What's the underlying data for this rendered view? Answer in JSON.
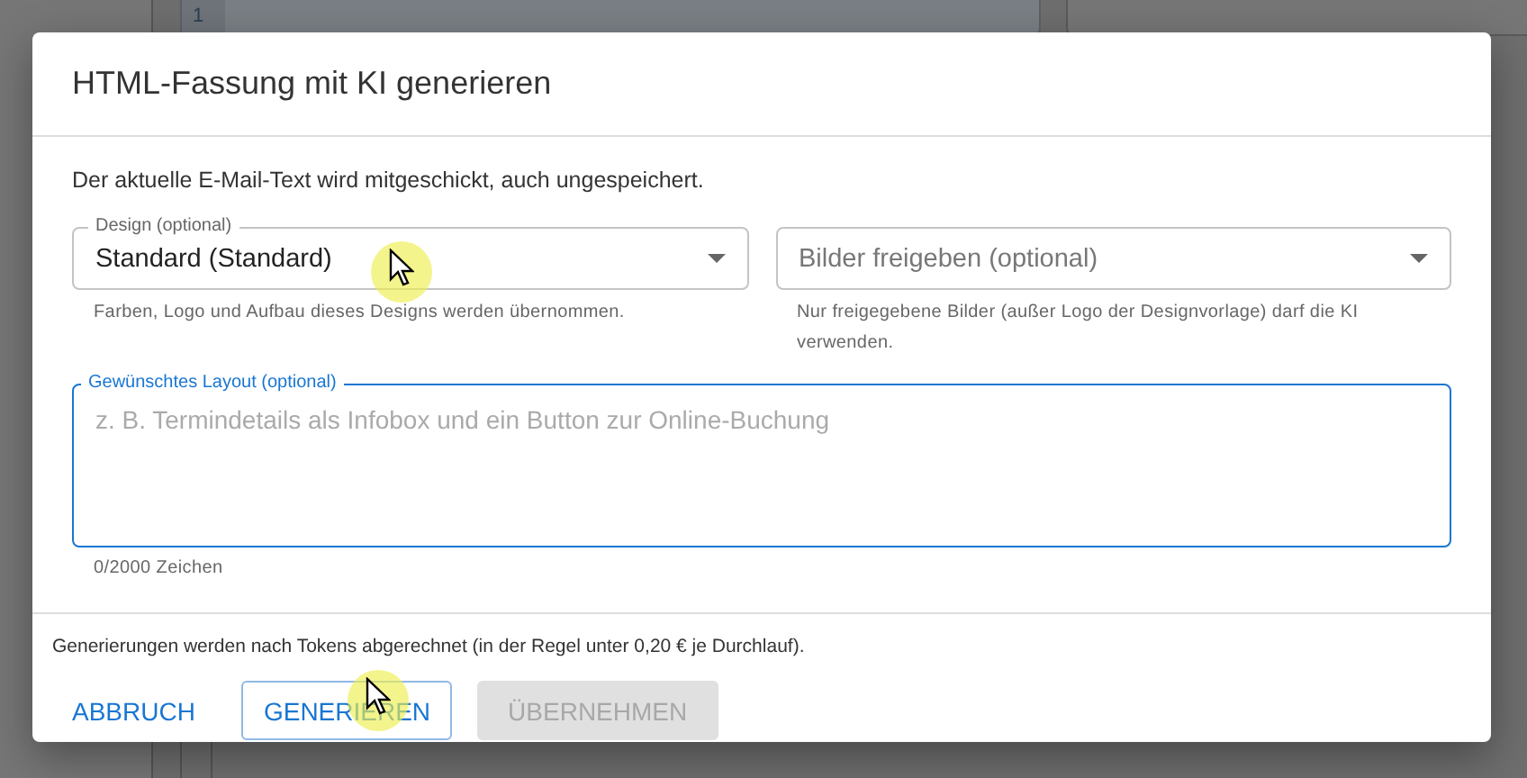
{
  "background": {
    "line_number": "1"
  },
  "dialog": {
    "title": "HTML-Fassung mit KI generieren",
    "intro": "Der aktuelle E-Mail-Text wird mitgeschickt, auch ungespeichert.",
    "selects": [
      {
        "label": "Design (optional)",
        "value": "Standard (Standard)",
        "helper": "Farben, Logo und Aufbau dieses Designs werden übernommen."
      },
      {
        "placeholder": "Bilder freigeben (optional)",
        "helper": "Nur freigegebene Bilder (außer Logo der Designvorlage) darf die KI verwenden."
      }
    ],
    "layout_field": {
      "label": "Gewünschtes Layout (optional)",
      "placeholder": "z. B. Termindetails als Infobox und ein Button zur Online-Buchung",
      "focused": true,
      "counter": "0/2000 Zeichen"
    },
    "footer_note": "Generierungen werden nach Tokens abgerechnet (in der Regel unter 0,20 € je Durchlauf).",
    "buttons": [
      {
        "label": "ABBRUCH",
        "kind": "text",
        "disabled": false
      },
      {
        "label": "GENERIEREN",
        "kind": "outlined",
        "disabled": false
      },
      {
        "label": "ÜBERNEHMEN",
        "kind": "contained",
        "disabled": true
      }
    ]
  }
}
